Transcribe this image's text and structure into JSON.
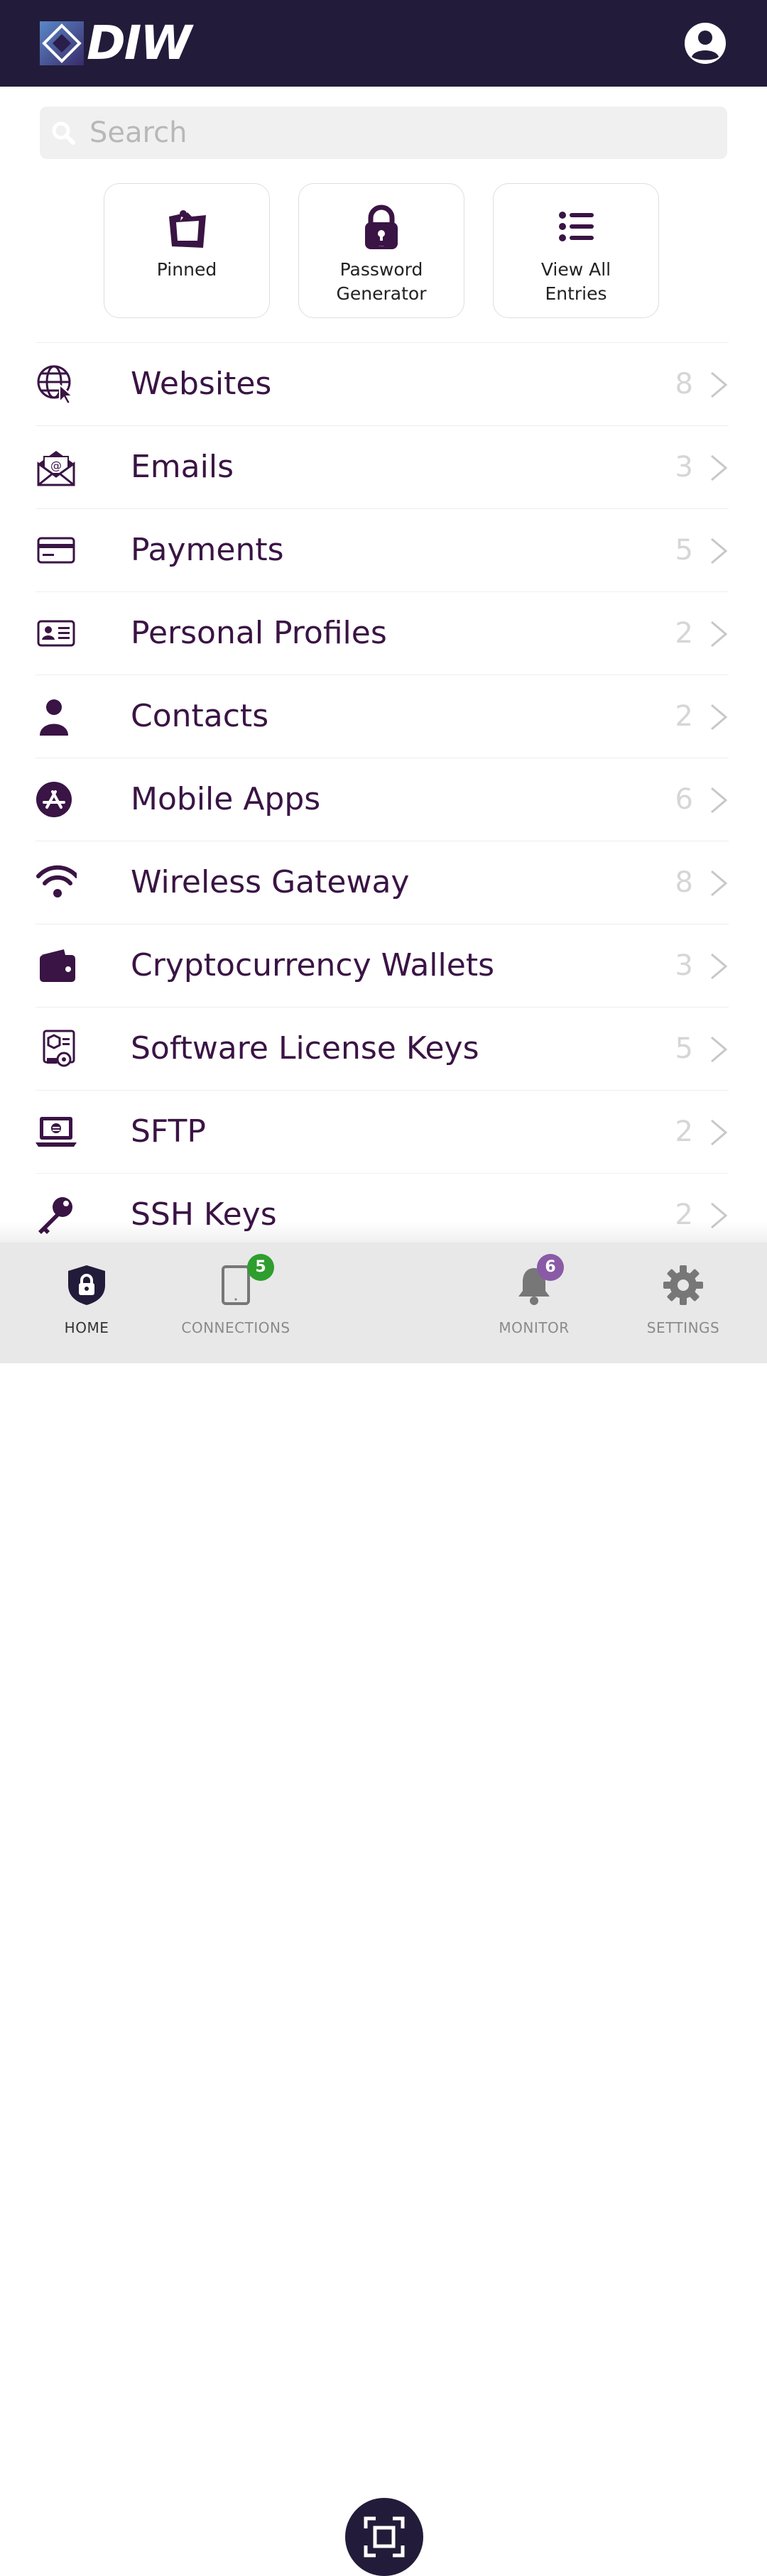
{
  "header": {
    "logo_text": "DIW",
    "profile_icon": "user-circle-icon"
  },
  "search": {
    "placeholder": "Search",
    "icon": "search-icon"
  },
  "tiles": [
    {
      "label": "Pinned",
      "icon": "pin-note-icon"
    },
    {
      "label": "Password\nGenerator",
      "icon": "padlock-icon"
    },
    {
      "label": "View All\nEntries",
      "icon": "list-icon"
    }
  ],
  "categories": [
    {
      "label": "Websites",
      "count": "8",
      "icon": "globe-cursor-icon"
    },
    {
      "label": "Emails",
      "count": "3",
      "icon": "envelope-icon"
    },
    {
      "label": "Payments",
      "count": "5",
      "icon": "credit-card-icon"
    },
    {
      "label": "Personal Profiles",
      "count": "2",
      "icon": "id-card-icon"
    },
    {
      "label": "Contacts",
      "count": "2",
      "icon": "person-icon"
    },
    {
      "label": "Mobile Apps",
      "count": "6",
      "icon": "app-store-icon"
    },
    {
      "label": "Wireless Gateway",
      "count": "8",
      "icon": "wifi-icon"
    },
    {
      "label": "Cryptocurrency Wallets",
      "count": "3",
      "icon": "wallet-icon"
    },
    {
      "label": "Software License Keys",
      "count": "5",
      "icon": "software-license-icon"
    },
    {
      "label": "SFTP",
      "count": "2",
      "icon": "laptop-icon"
    },
    {
      "label": "SSH Keys",
      "count": "2",
      "icon": "key-icon"
    }
  ],
  "tabbar": {
    "home": {
      "label": "HOME",
      "icon": "shield-lock-icon"
    },
    "connections": {
      "label": "CONNECTIONS",
      "badge": "5",
      "icon": "tablet-icon"
    },
    "scan": {
      "icon": "scan-icon"
    },
    "monitor": {
      "label": "MONITOR",
      "badge": "6",
      "icon": "bell-icon"
    },
    "settings": {
      "label": "SETTINGS",
      "icon": "gear-icon"
    }
  },
  "colors": {
    "header_bg": "#221c3a",
    "accent": "#3a1444",
    "badge_green": "#2e9e2e",
    "badge_purple": "#8a5aa6"
  }
}
